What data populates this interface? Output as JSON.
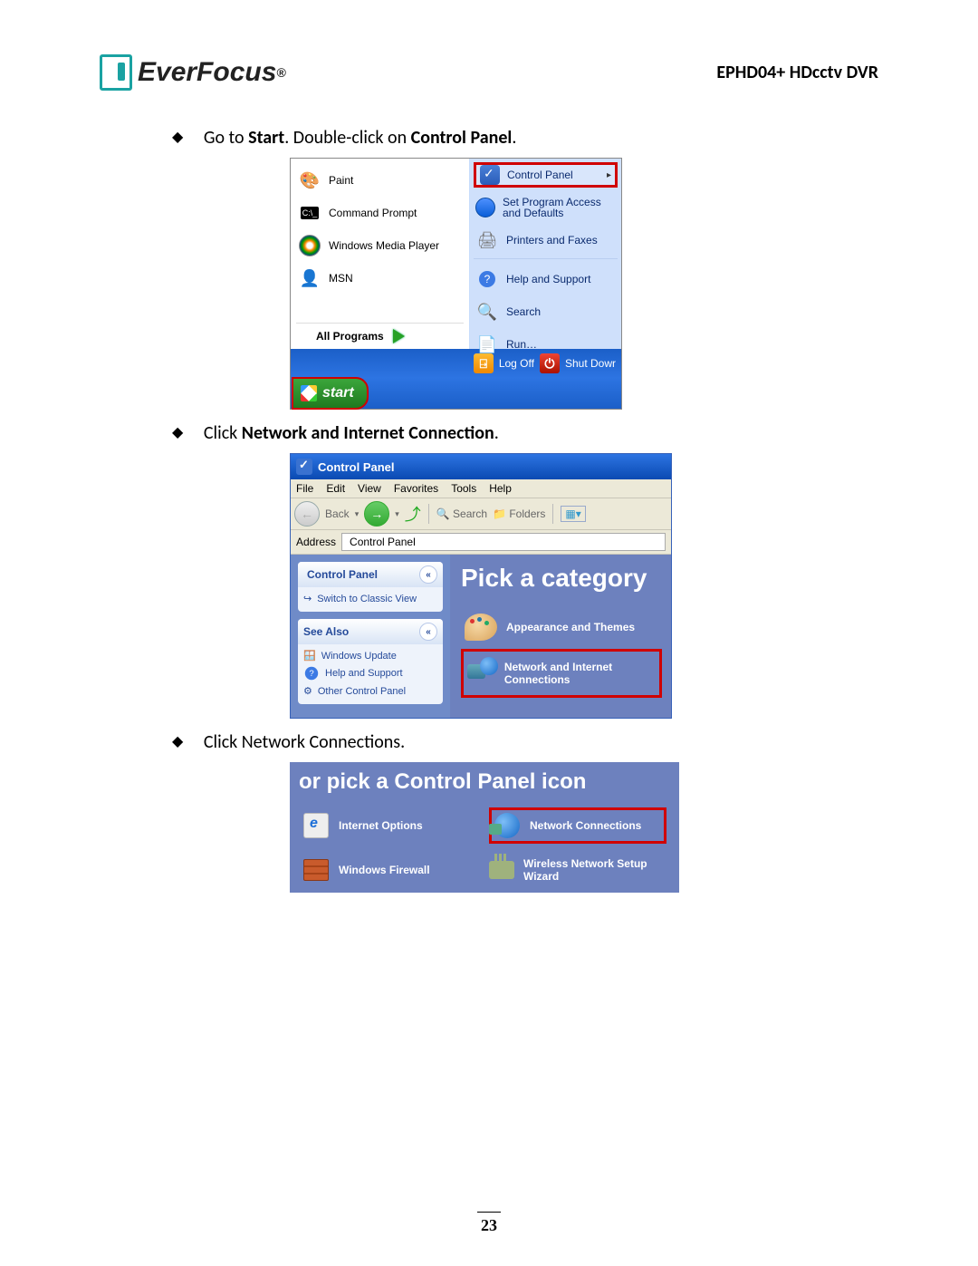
{
  "header": {
    "brand": "EverFocus",
    "doc_title": "EPHD04+  HDcctv DVR"
  },
  "step1": {
    "bullet_prefix": "Go to ",
    "bullet_bold1": "Start",
    "bullet_mid": ". Double-click on ",
    "bullet_bold2": "Control Panel",
    "bullet_end": ".",
    "start_menu": {
      "left": [
        "Paint",
        "Command Prompt",
        "Windows Media Player",
        "MSN"
      ],
      "all_programs": "All Programs",
      "right_highlight": "Control Panel",
      "right": [
        "Set Program Access and Defaults",
        "Printers and Faxes",
        "Help and Support",
        "Search",
        "Run…"
      ],
      "logoff": "Log Off",
      "shutdown": "Shut Dowr",
      "start": "start"
    }
  },
  "step2": {
    "bullet_prefix": "Click ",
    "bullet_bold": "Network and Internet Connection",
    "bullet_end": ".",
    "window": {
      "title": "Control Panel",
      "menu": [
        "File",
        "Edit",
        "View",
        "Favorites",
        "Tools",
        "Help"
      ],
      "toolbar": {
        "back": "Back",
        "search": "Search",
        "folders": "Folders"
      },
      "address_label": "Address",
      "address_value": "Control Panel",
      "task_cp": {
        "title": "Control Panel",
        "switch": "Switch to Classic View"
      },
      "task_see": {
        "title": "See Also",
        "items": [
          "Windows Update",
          "Help and Support",
          "Other Control Panel"
        ]
      },
      "pick_label": "Pick a category",
      "cat_appearance": "Appearance and Themes",
      "cat_network": "Network and Internet Connections"
    }
  },
  "step3": {
    "bullet": "Click Network Connections.",
    "title": "or pick a Control Panel icon",
    "opts": {
      "io": "Internet Options",
      "nc": "Network Connections",
      "fw": "Windows Firewall",
      "wiz": "Wireless Network Setup Wizard"
    }
  },
  "page_number": "23"
}
